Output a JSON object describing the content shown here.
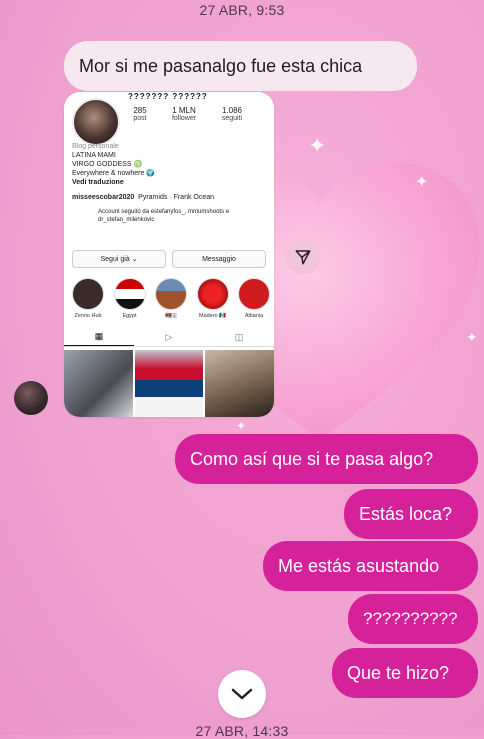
{
  "timestamps": {
    "top": "27 ABR, 9:53",
    "bottom": "27 ABR, 14:33"
  },
  "messages": {
    "received_1": "Mor si me pasanalgo fue esta chica",
    "sent": [
      "Como así que si te pasa algo?",
      "Estás loca?",
      "Me estás asustando",
      "??????????",
      "Que te hizo?"
    ]
  },
  "shared_profile": {
    "username": "??????? ??????",
    "stats": [
      {
        "value": "285",
        "label": "post"
      },
      {
        "value": "1 MLN",
        "label": "follower"
      },
      {
        "value": "1.086",
        "label": "seguiti"
      }
    ],
    "bio_category": "Blog personale",
    "bio_lines": [
      "LATINA MAMI",
      "VIRGO GODDESS ♍",
      "Everywhere & nowhere 🌍"
    ],
    "bio_translate": "Vedi traduzione",
    "link_handle": "misseescobar2020",
    "music": "Pyramids · Frank Ocean",
    "followed_by": "Account seguito da estefanyfos_, mmumshoots e dr_stefan_milenkovic",
    "buttons": {
      "follow": "Segui già ⌄",
      "message": "Messaggio"
    },
    "highlights": [
      "Zenno Hub",
      "Egypt",
      "🇸🇷🇸",
      "Madero 🇲🇽",
      "Albania"
    ]
  },
  "colors": {
    "sent_bubble": "#d6229a",
    "received_bubble": "#f6e8ef",
    "background": "#f3a5d2"
  },
  "icons": {
    "share": "send-icon",
    "scroll": "chevron-down-icon"
  }
}
